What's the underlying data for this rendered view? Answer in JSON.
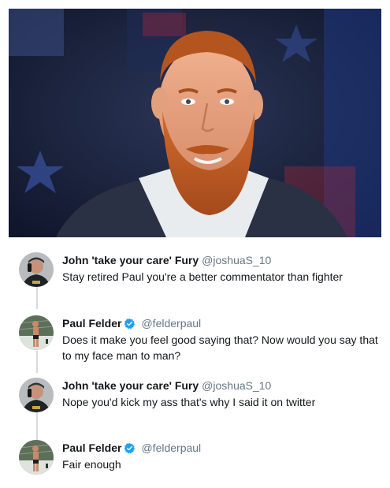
{
  "tweets": [
    {
      "name": "John 'take your care' Fury",
      "handle": "@joshuaS_10",
      "verified": false,
      "text": "Stay retired Paul you're a better commentator than fighter",
      "avatar_icon": "man-on-phone-avatar"
    },
    {
      "name": "Paul Felder",
      "handle": "@felderpaul",
      "verified": true,
      "text": "Does it make you feel good saying that? Now would you say that to my face man to man?",
      "avatar_icon": "fighter-in-octagon-avatar"
    },
    {
      "name": "John 'take your care' Fury",
      "handle": "@joshuaS_10",
      "verified": false,
      "text": "Nope you'd kick my ass that's why I said it on twitter",
      "avatar_icon": "man-on-phone-avatar"
    },
    {
      "name": "Paul Felder",
      "handle": "@felderpaul",
      "verified": true,
      "text": "Fair enough",
      "avatar_icon": "fighter-in-octagon-avatar"
    }
  ],
  "colors": {
    "verified_badge": "#1da1f2",
    "handle": "#657786",
    "text": "#14171a",
    "thread_line": "#d6dbe0"
  }
}
